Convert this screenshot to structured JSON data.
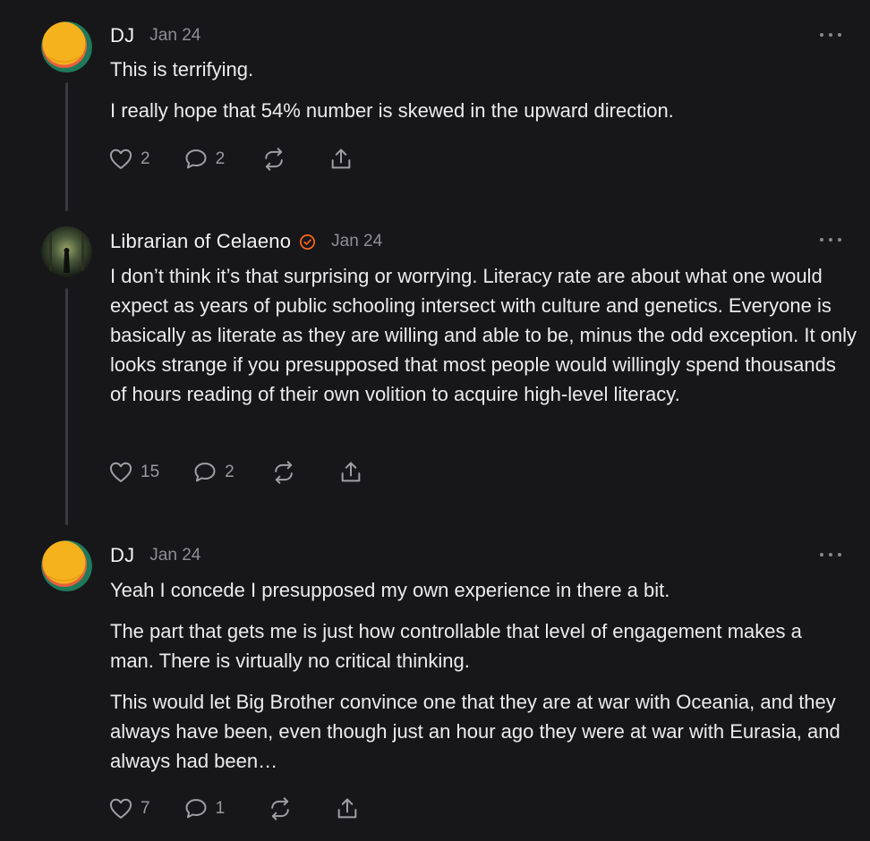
{
  "comments": [
    {
      "author": "DJ",
      "date": "Jan 24",
      "verified": false,
      "paragraphs": [
        "This is terrifying.",
        "I really hope that 54% number is skewed in the upward direction."
      ],
      "likes": "2",
      "replies": "2"
    },
    {
      "author": "Librarian of Celaeno",
      "date": "Jan 24",
      "verified": true,
      "paragraphs": [
        "I don’t think it’s that surprising or worrying. Literacy rate are about what one would expect as years of public schooling intersect with culture and genetics. Everyone is basically as literate as they are willing and able to be, minus the odd exception. It only looks strange if you presupposed that most people would willingly spend thousands of hours reading of their own volition to acquire high-level literacy."
      ],
      "likes": "15",
      "replies": "2"
    },
    {
      "author": "DJ",
      "date": "Jan 24",
      "verified": false,
      "paragraphs": [
        "Yeah I concede I presupposed my own experience in there a bit.",
        "The part that gets me is just how controllable that level of engagement makes a man. There is virtually no critical thinking.",
        "This would let Big Brother convince one that they are at war with Oceania, and they always have been, even though just an hour ago they were at war with Eurasia, and always had been…"
      ],
      "likes": "7",
      "replies": "1"
    }
  ],
  "icons": {
    "like": "heart-icon",
    "reply": "comment-bubble-icon",
    "restack": "restack-icon",
    "share": "share-icon",
    "more": "more-dots-icon",
    "verified": "verified-badge-icon"
  },
  "colors": {
    "background": "#17171a",
    "text": "#ececec",
    "muted": "#8e8e93",
    "verified": "#ff6719"
  }
}
